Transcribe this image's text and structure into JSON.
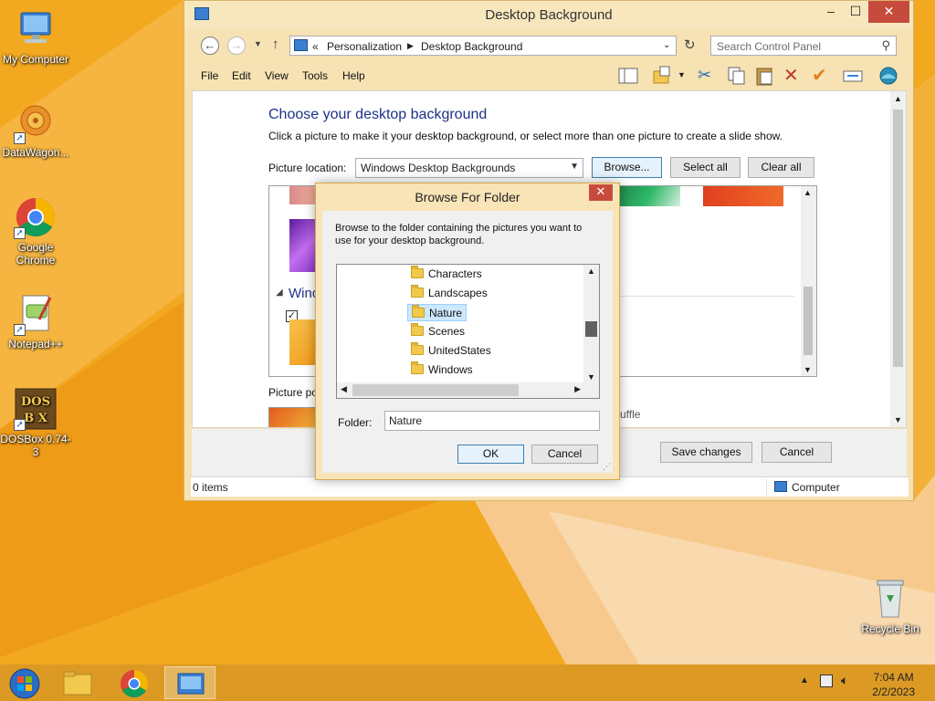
{
  "desktop": {
    "icons": [
      {
        "name": "my-computer",
        "label": "My Computer"
      },
      {
        "name": "datawagon",
        "label": "DataWagon..."
      },
      {
        "name": "google-chrome",
        "label": "Google Chrome"
      },
      {
        "name": "notepad-plus-plus",
        "label": "Notepad++"
      },
      {
        "name": "dosbox",
        "label": "DOSBox 0.74-3"
      },
      {
        "name": "recycle-bin",
        "label": "Recycle Bin"
      }
    ]
  },
  "window": {
    "title": "Desktop Background",
    "breadcrumb": {
      "chevrons": "«",
      "part1": "Personalization",
      "part2": "Desktop Background"
    },
    "search_placeholder": "Search Control Panel",
    "menu": {
      "file": "File",
      "edit": "Edit",
      "view": "View",
      "tools": "Tools",
      "help": "Help"
    },
    "heading": "Choose your desktop background",
    "subheading": "Click a picture to make it your desktop background, or select more than one picture to create a slide show.",
    "picture_location_label": "Picture location:",
    "picture_location_value": "Windows Desktop Backgrounds",
    "browse_label": "Browse...",
    "select_all_label": "Select all",
    "clear_all_label": "Clear all",
    "group_label_partial": "Windo",
    "picture_position_partial": "Picture po",
    "shuffle_partial": "uffle",
    "save_label": "Save changes",
    "cancel_label": "Cancel",
    "status_items": "0 items",
    "status_location": "Computer"
  },
  "dialog": {
    "title": "Browse For Folder",
    "description": "Browse to the folder containing the pictures you want to use for your desktop background.",
    "folders": [
      "Characters",
      "Landscapes",
      "Nature",
      "Scenes",
      "UnitedStates",
      "Windows"
    ],
    "selected_folder": "Nature",
    "folder_label": "Folder:",
    "folder_value": "Nature",
    "ok_label": "OK",
    "cancel_label": "Cancel"
  },
  "taskbar": {
    "time": "7:04 AM",
    "date": "2/2/2023"
  },
  "colors": {
    "accent": "#f0a51c",
    "window_frame": "#f6e2b3",
    "heading_blue": "#1e3287",
    "close_red": "#c74b3c"
  }
}
